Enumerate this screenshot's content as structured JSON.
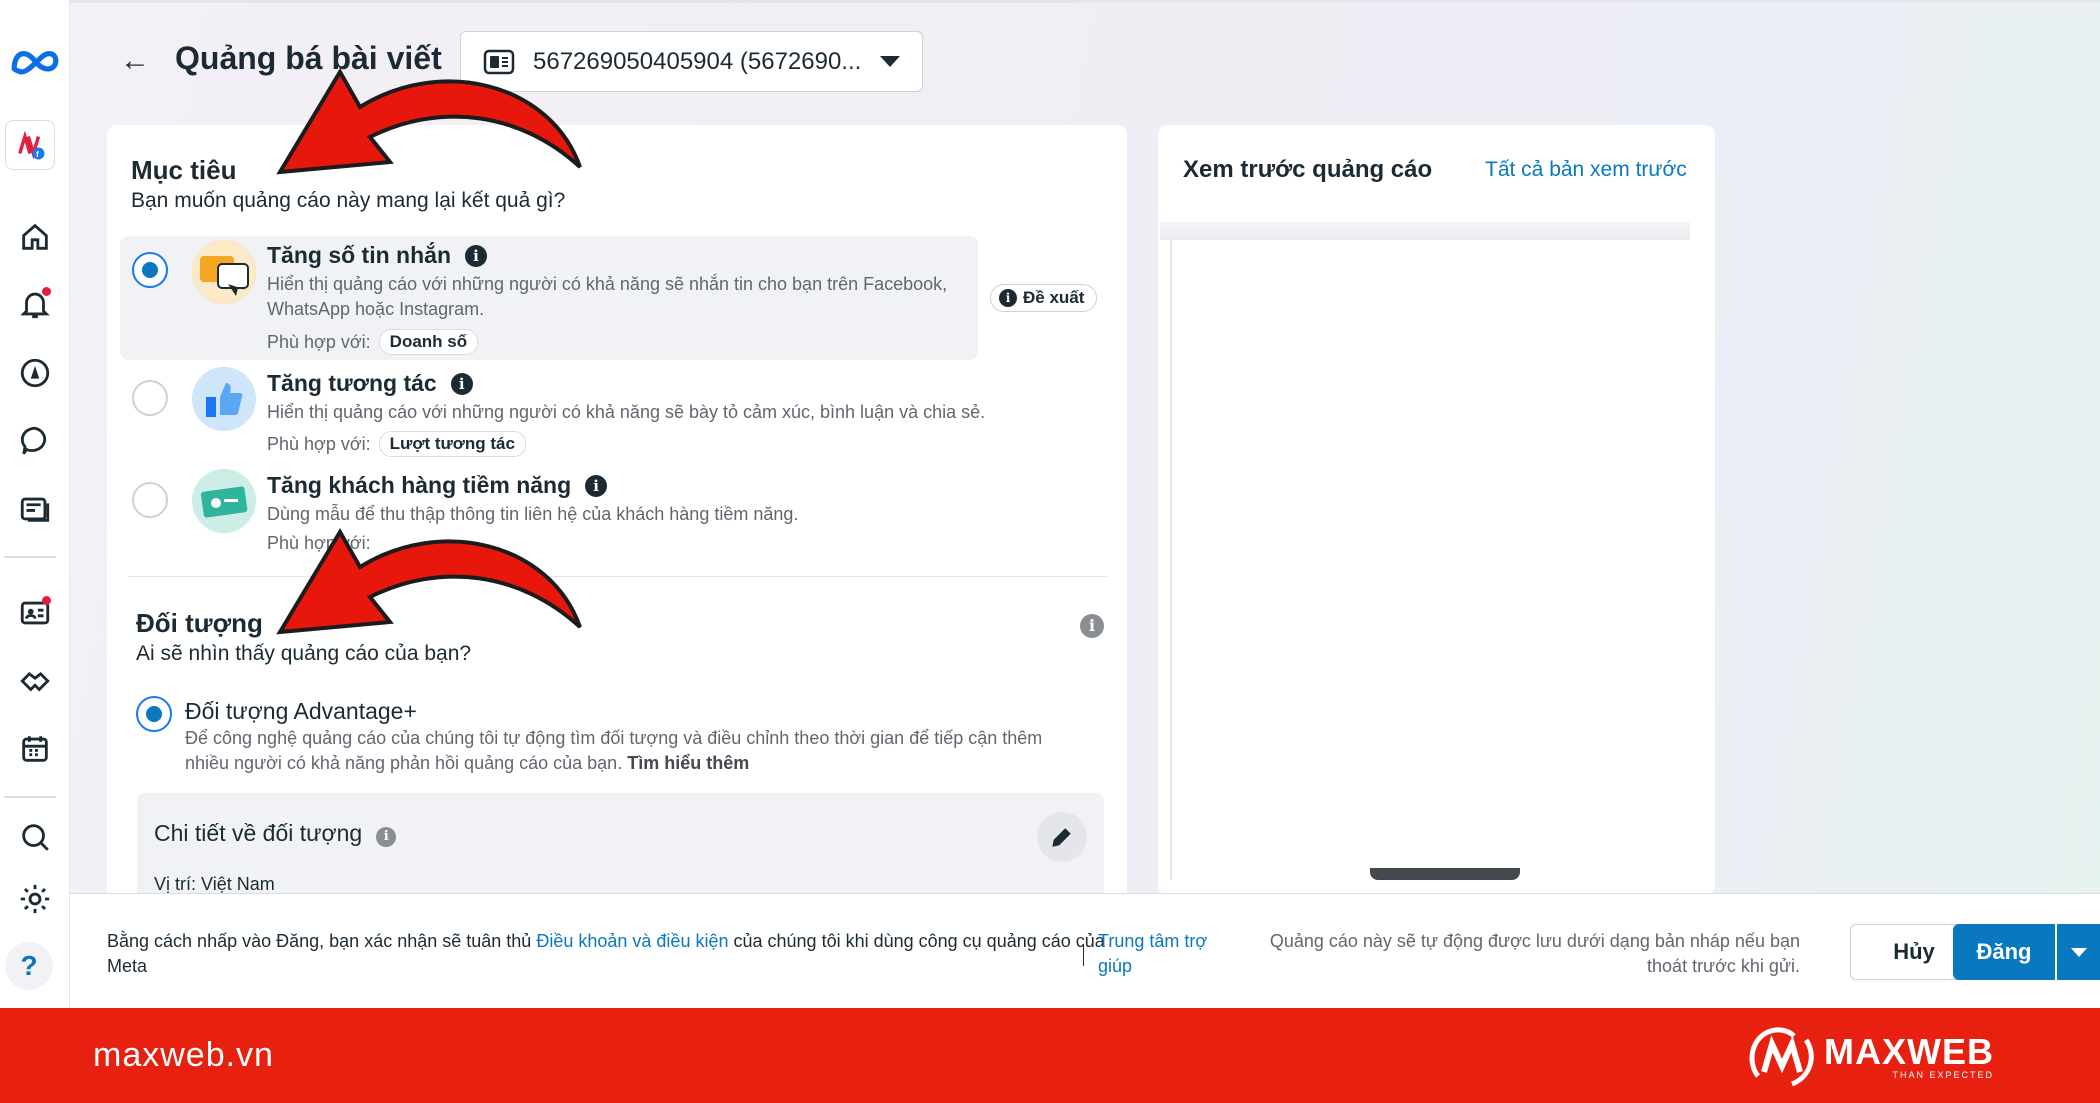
{
  "header": {
    "title": "Quảng bá bài viết",
    "page_selector": "567269050405904 (5672690..."
  },
  "objective": {
    "title": "Mục tiêu",
    "subtitle": "Bạn muốn quảng cáo này mang lại kết quả gì?",
    "options": [
      {
        "title": "Tăng số tin nhắn",
        "description": "Hiển thị quảng cáo với những người có khả năng sẽ nhắn tin cho bạn trên Facebook, WhatsApp hoặc Instagram.",
        "fit_label": "Phù hợp với:",
        "fit_value": "Doanh số",
        "selected": true
      },
      {
        "title": "Tăng tương tác",
        "description": "Hiển thị quảng cáo với những người có khả năng sẽ bày tỏ cảm xúc, bình luận và chia sẻ.",
        "fit_label": "Phù hợp với:",
        "fit_value": "Lượt tương tác",
        "selected": false
      },
      {
        "title": "Tăng khách hàng tiềm năng",
        "description": "Dùng mẫu để thu thập thông tin liên hệ của khách hàng tiềm năng.",
        "fit_label": "Phù hợp với:",
        "selected": false
      }
    ],
    "recommended_badge": "Đề xuất"
  },
  "audience": {
    "title": "Đối tượng",
    "subtitle": "Ai sẽ nhìn thấy quảng cáo của bạn?",
    "option_title": "Đối tượng Advantage+",
    "option_desc": "Để công nghệ quảng cáo của chúng tôi tự động tìm đối tượng và điều chỉnh theo thời gian để tiếp cận thêm nhiều người có khả năng phản hồi quảng cáo của bạn.",
    "learn_more": "Tìm hiểu thêm",
    "details_title": "Chi tiết về đối tượng",
    "location_label": "Vị trí:",
    "location_value": "Việt Nam"
  },
  "preview": {
    "title": "Xem trước quảng cáo",
    "all_previews": "Tất cả bản xem trước"
  },
  "footer": {
    "terms_prefix": "Bằng cách nhấp vào Đăng, bạn xác nhận sẽ tuân thủ",
    "terms_link": "Điều khoản và điều kiện",
    "terms_suffix": "của chúng tôi khi dùng công cụ quảng cáo của Meta",
    "help_center": "Trung tâm trợ giúp",
    "draft_note": "Quảng cáo này sẽ tự động được lưu dưới dạng bản nháp nếu bạn thoát trước khi gửi.",
    "cancel": "Hủy",
    "post": "Đăng"
  },
  "help_button": "?",
  "brand": {
    "url": "maxweb.vn",
    "name": "MAXWEB",
    "tagline": "THAN EXPECTED"
  },
  "colors": {
    "accent": "#0a78be",
    "brand_red": "#e8200f",
    "notification": "#e41e3f"
  }
}
